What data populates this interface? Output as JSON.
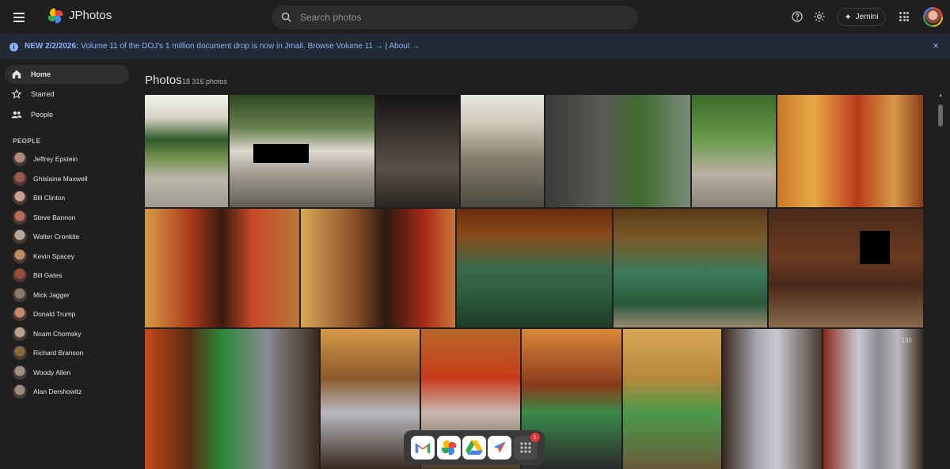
{
  "header": {
    "app_title": "JPhotos",
    "search_placeholder": "Search photos",
    "jemini_label": "Jemini"
  },
  "banner": {
    "date": "NEW 2/2/2026:",
    "message": " Volume 11 of the DOJ's 1 million document drop is now in Jmail. ",
    "link_volume": "Browse Volume 11 →",
    "separator": " | ",
    "link_about": "About →",
    "close_symbol": "×"
  },
  "sidebar": {
    "nav": [
      {
        "label": "Home",
        "icon": "home-icon",
        "active": true
      },
      {
        "label": "Starred",
        "icon": "star-icon",
        "active": false
      },
      {
        "label": "People",
        "icon": "people-icon",
        "active": false
      }
    ],
    "people_header": "PEOPLE",
    "people": [
      {
        "name": "Jeffrey Epstein",
        "color": "#b08978"
      },
      {
        "name": "Ghislaine Maxwell",
        "color": "#9a5a4a"
      },
      {
        "name": "Bill Clinton",
        "color": "#c9a08c"
      },
      {
        "name": "Steve Bannon",
        "color": "#b86a55"
      },
      {
        "name": "Walter Cronkite",
        "color": "#b9a79a"
      },
      {
        "name": "Kevin Spacey",
        "color": "#c48a5a"
      },
      {
        "name": "Bill Gates",
        "color": "#a04a3a"
      },
      {
        "name": "Mick Jagger",
        "color": "#8a7a70"
      },
      {
        "name": "Donald Trump",
        "color": "#c48a6a"
      },
      {
        "name": "Noam Chomsky",
        "color": "#b8a090"
      },
      {
        "name": "Richard Branson",
        "color": "#8a6a40"
      },
      {
        "name": "Woody Allen",
        "color": "#a09080"
      },
      {
        "name": "Alan Dershowitz",
        "color": "#9a8a80"
      }
    ]
  },
  "main": {
    "title": "Photos",
    "count": "18 316 photos",
    "star_badge": "☆ 130"
  },
  "dock": {
    "badge_count": "1"
  },
  "colors": {
    "accent_blue": "#8ab4f8",
    "background": "#1f1f1f",
    "banner_bg": "#222a36"
  }
}
